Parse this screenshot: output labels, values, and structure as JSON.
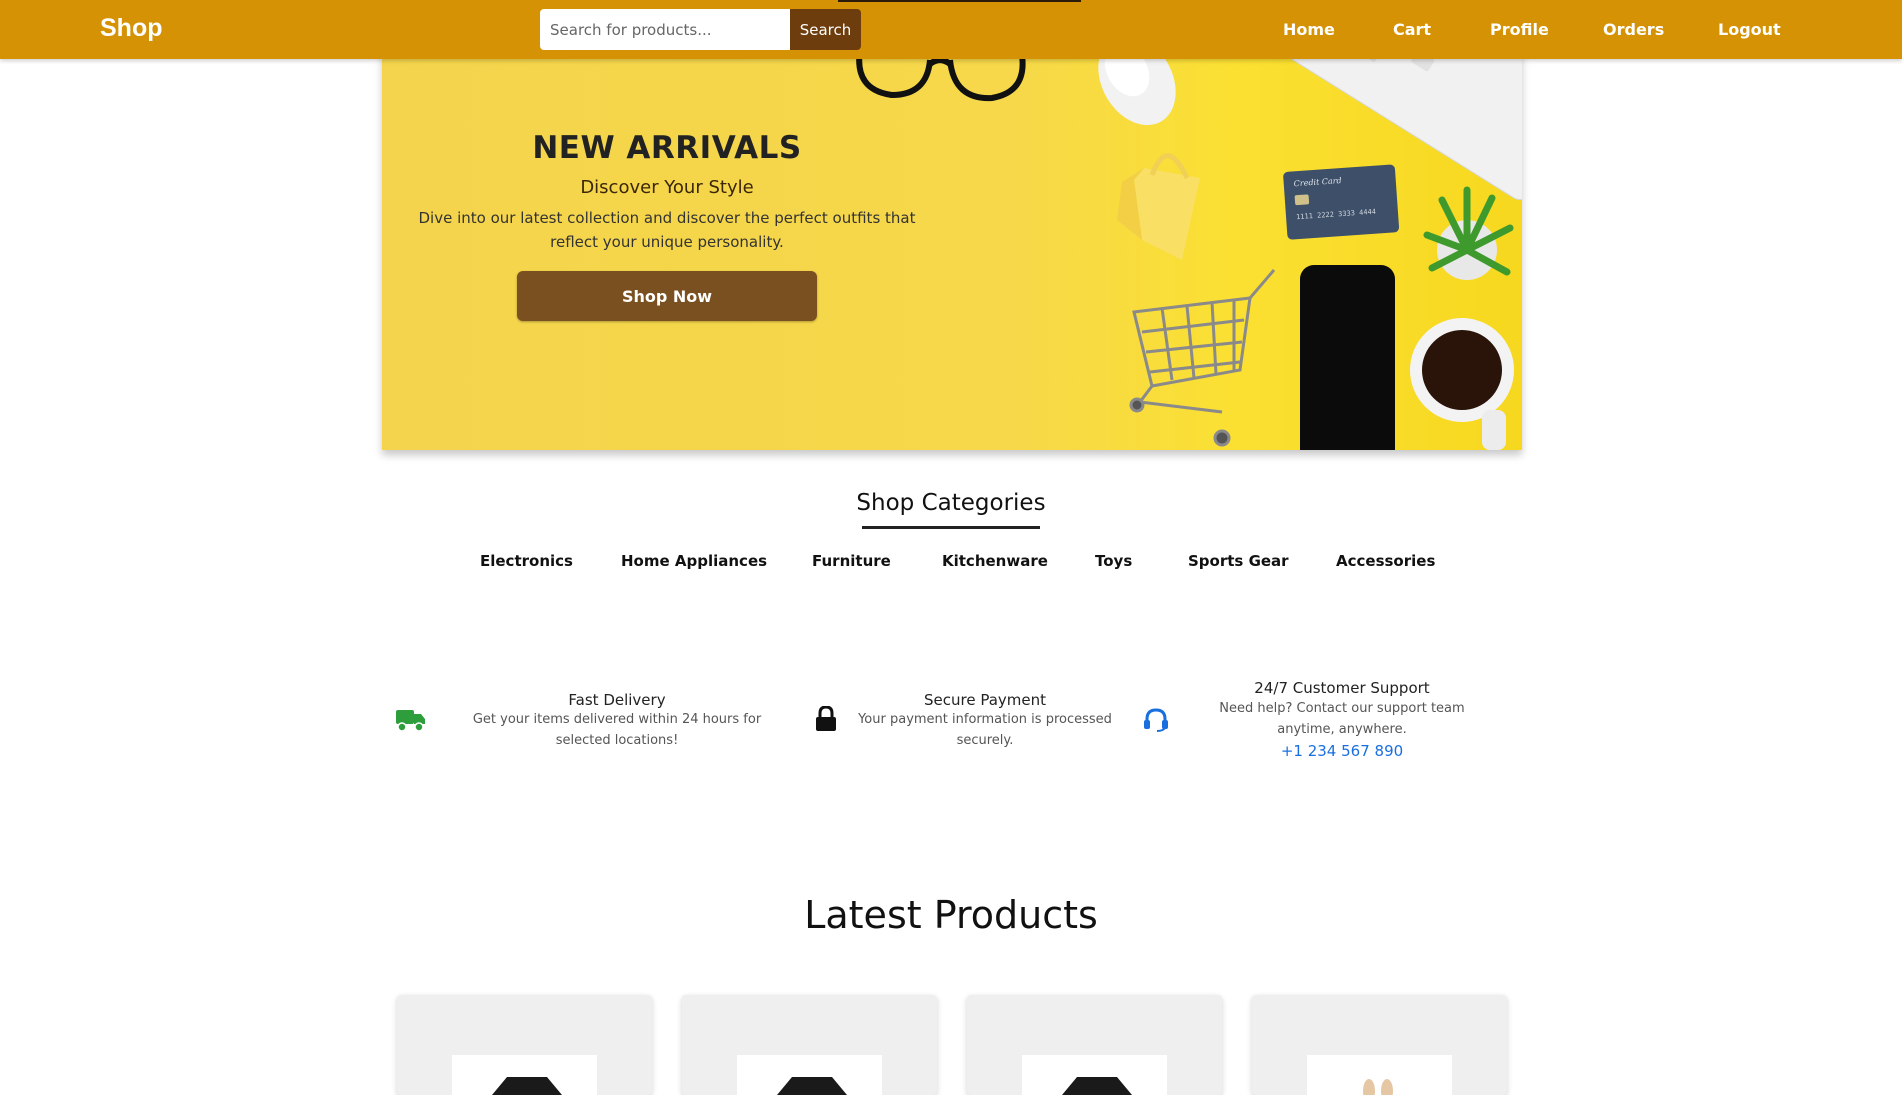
{
  "header": {
    "brand": "Shop",
    "search_placeholder": "Search for products...",
    "search_button": "Search",
    "nav": [
      "Home",
      "Cart",
      "Profile",
      "Orders",
      "Logout"
    ]
  },
  "hero": {
    "title": "NEW ARRIVALS",
    "subtitle": "Discover Your Style",
    "text": "Dive into our latest collection and discover the perfect outfits that reflect your unique personality.",
    "button": "Shop Now",
    "card_line1": "Credit Card",
    "card_number": "1111 2222 3333 4444"
  },
  "categories": {
    "heading": "Shop Categories",
    "items": [
      "Electronics",
      "Home Appliances",
      "Furniture",
      "Kitchenware",
      "Toys",
      "Sports Gear",
      "Accessories"
    ]
  },
  "features": [
    {
      "icon": "truck-icon",
      "title": "Fast Delivery",
      "desc": "Get your items delivered within 24 hours for selected locations!"
    },
    {
      "icon": "lock-icon",
      "title": "Secure Payment",
      "desc": "Your payment information is processed securely."
    },
    {
      "icon": "headset-icon",
      "title": "24/7 Customer Support",
      "desc": "Need help? Contact our support team anytime, anywhere.",
      "phone": "+1 234 567 890"
    }
  ],
  "latest": {
    "title": "Latest Products"
  },
  "colors": {
    "header": "#d49204",
    "button_brown": "#7a5020",
    "search_button": "#6e3d0d",
    "link_blue": "#1a6fe0",
    "delivery_green": "#2e9e3c"
  }
}
